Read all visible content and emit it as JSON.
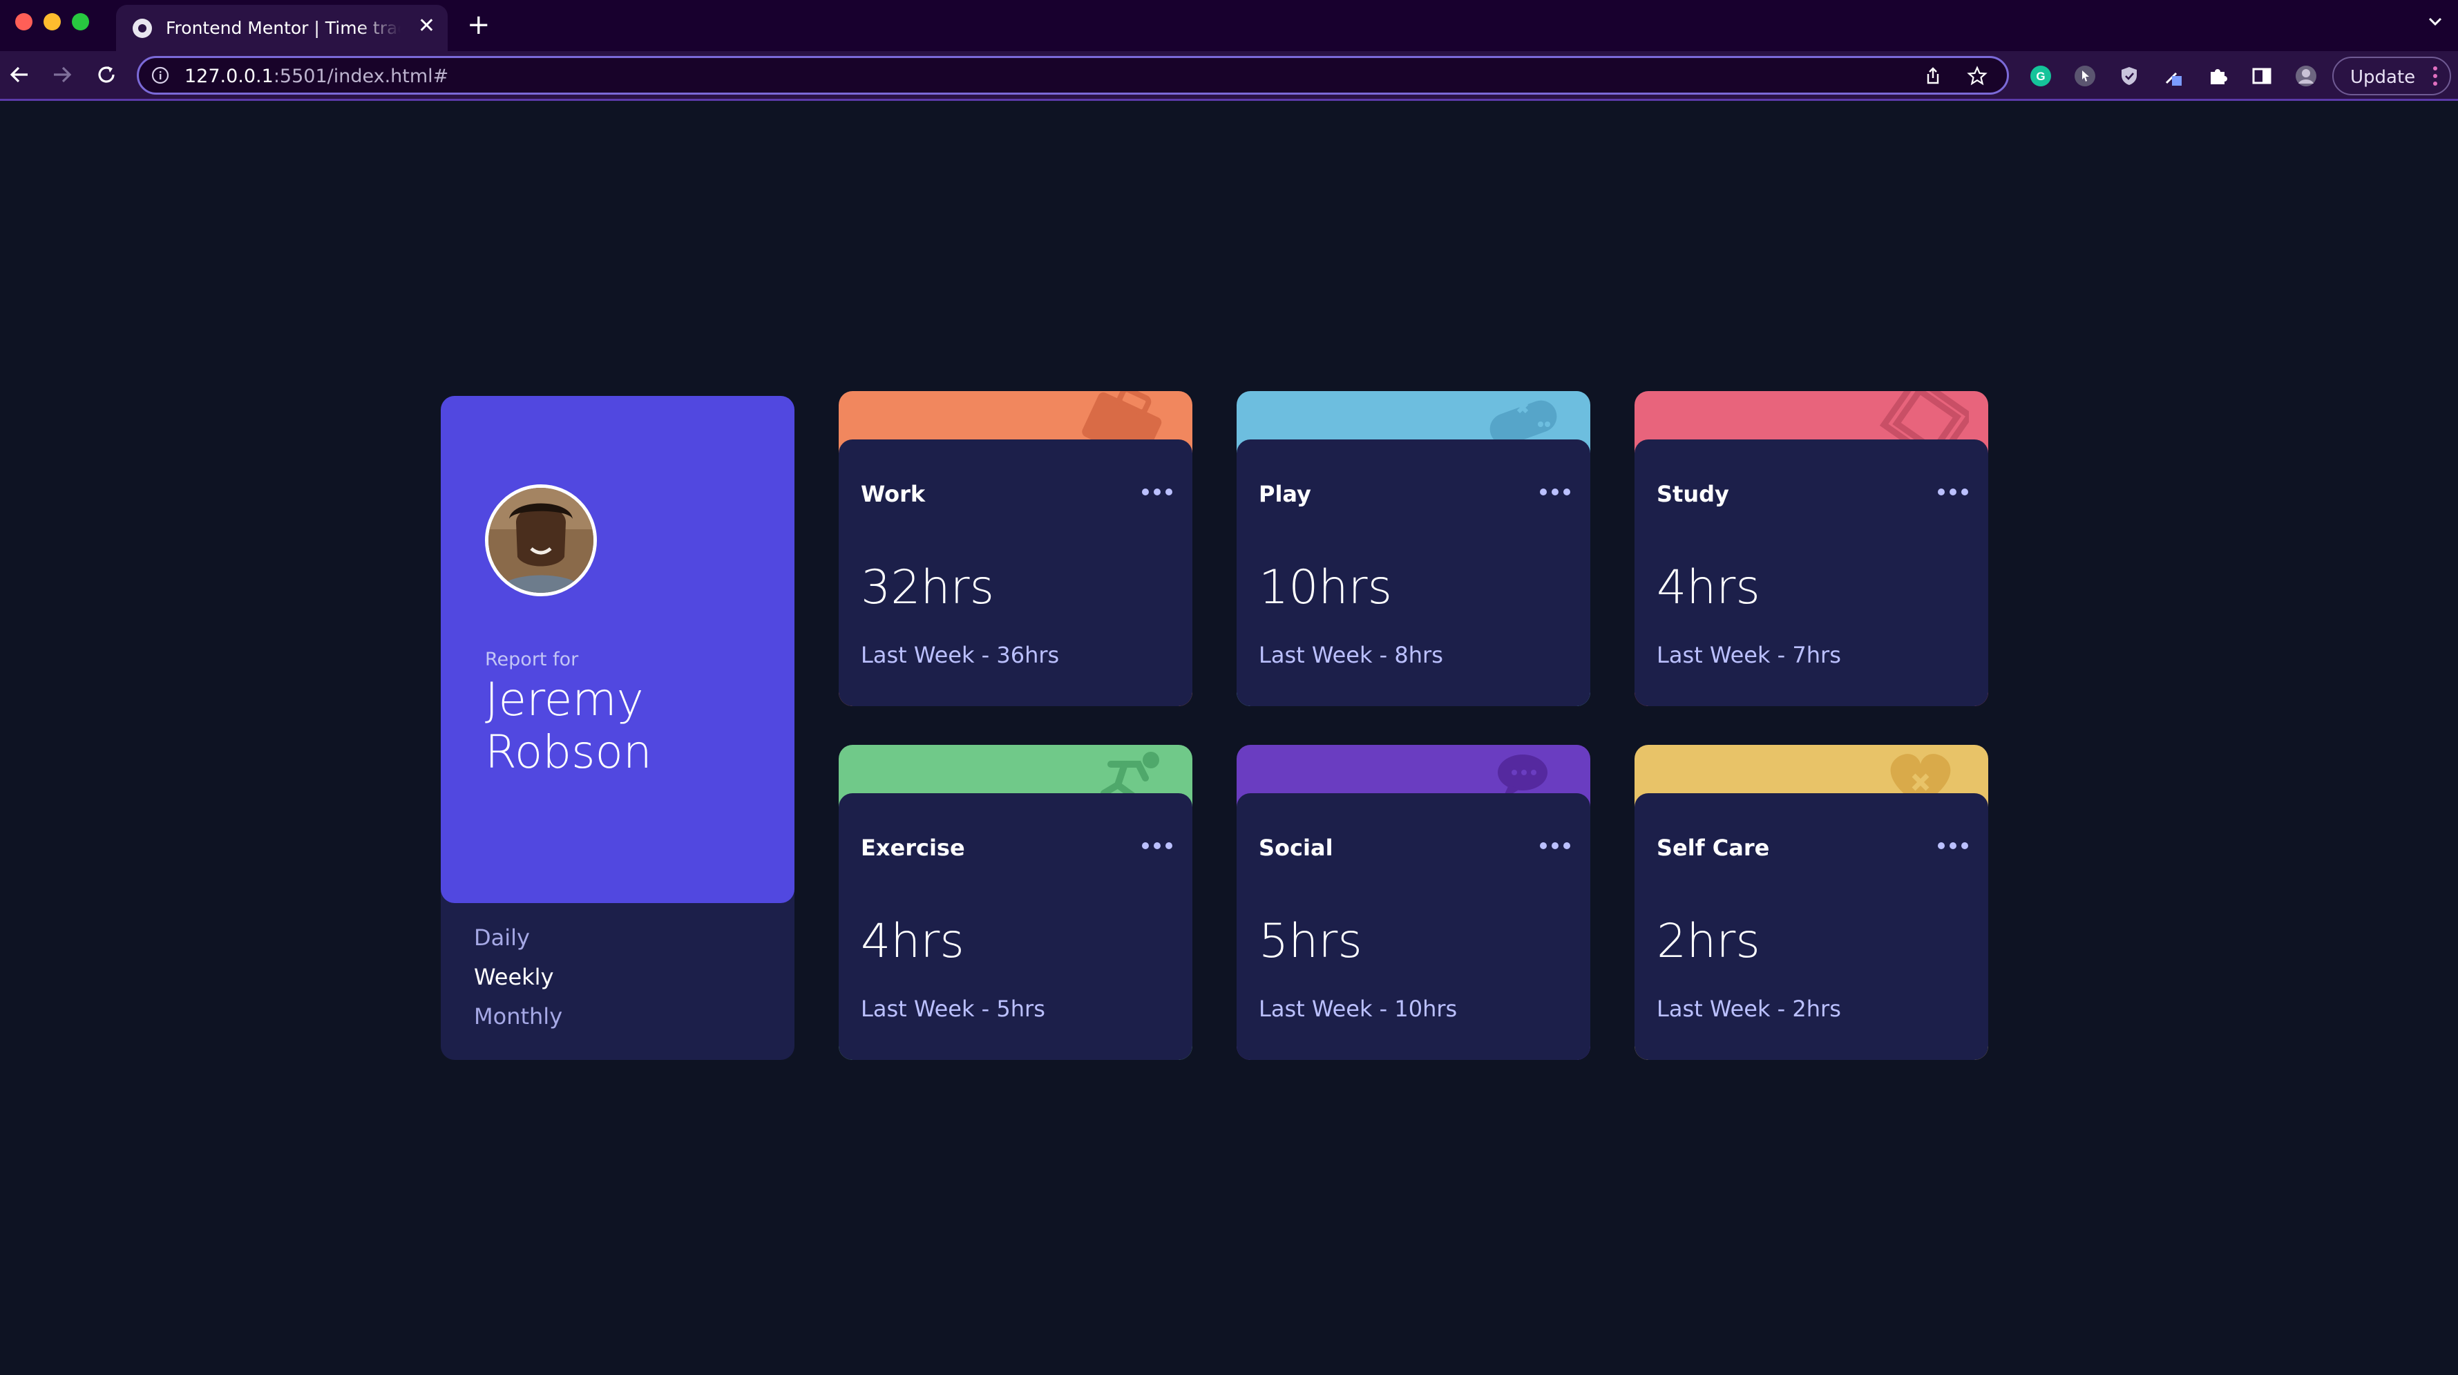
{
  "browser": {
    "tab_title": "Frontend Mentor | Time tracking dashboard",
    "new_tab_label": "+",
    "close_label": "✕",
    "url_host": "127.0.0.1",
    "url_rest": ":5501/index.html#",
    "update_label": "Update",
    "accent_color": "#7b6ad8"
  },
  "profile": {
    "report_for": "Report for",
    "name": "Jeremy Robson",
    "periods": [
      {
        "label": "Daily",
        "active": false
      },
      {
        "label": "Weekly",
        "active": true
      },
      {
        "label": "Monthly",
        "active": false
      }
    ]
  },
  "activities": [
    {
      "title": "Work",
      "current": "32hrs",
      "previous": "Last Week - 36hrs",
      "color": "#f1875e",
      "icon": "briefcase-icon"
    },
    {
      "title": "Play",
      "current": "10hrs",
      "previous": "Last Week - 8hrs",
      "color": "#6dbedf",
      "icon": "game-controller-icon"
    },
    {
      "title": "Study",
      "current": "4hrs",
      "previous": "Last Week - 7hrs",
      "color": "#e8647c",
      "icon": "book-icon"
    },
    {
      "title": "Exercise",
      "current": "4hrs",
      "previous": "Last Week - 5hrs",
      "color": "#70c989",
      "icon": "running-person-icon"
    },
    {
      "title": "Social",
      "current": "5hrs",
      "previous": "Last Week - 10hrs",
      "color": "#6a3dc1",
      "icon": "chat-bubble-icon"
    },
    {
      "title": "Self Care",
      "current": "2hrs",
      "previous": "Last Week - 2hrs",
      "color": "#e8c368",
      "icon": "heart-icon"
    }
  ]
}
